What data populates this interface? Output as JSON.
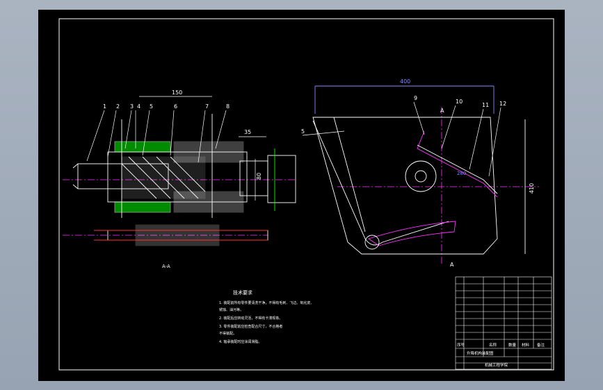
{
  "drawing": {
    "section_label": "A-A",
    "section_marker": "A",
    "part_numbers": [
      "1",
      "2",
      "3",
      "4",
      "5",
      "6",
      "7",
      "8",
      "9",
      "10",
      "11",
      "12",
      "5"
    ],
    "dimensions": {
      "d150": "150",
      "d35": "35",
      "d80": "80",
      "d400": "400",
      "d410": "410",
      "d280": "280"
    }
  },
  "notes": {
    "title": "技术要求",
    "lines": [
      "1. 装配前所有零件要清洗干净，不得有毛刺、飞边、氧化皮、",
      "   锈蚀、油污等。",
      "2. 装配后应转动灵活，不得有卡滞现象。",
      "3. 零件装配前应检查配合尺寸，不合格者",
      "   不得装配。",
      "4. 轴承装配时应涂润滑脂。"
    ]
  },
  "title_block": {
    "header": [
      "序号",
      "名称",
      "数量",
      "材料",
      "备注"
    ],
    "drawing_name": "升降机构装配图",
    "school": "机械工程学院"
  }
}
